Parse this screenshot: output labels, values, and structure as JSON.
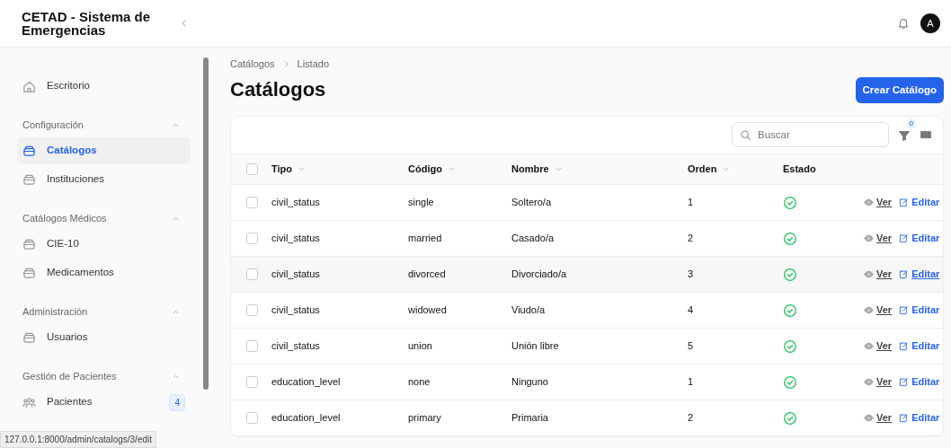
{
  "sidebar": {
    "title": "CETAD - Sistema de Emergencias",
    "top_items": [
      {
        "label": "Escritorio",
        "kind": "home",
        "selected": false
      }
    ],
    "groups": [
      {
        "title": "Configuración",
        "expanded": true,
        "items": [
          {
            "label": "Catálogos",
            "kind": "box",
            "selected": true
          },
          {
            "label": "Instituciones",
            "kind": "box",
            "selected": false
          }
        ]
      },
      {
        "title": "Catálogos Médicos",
        "expanded": true,
        "items": [
          {
            "label": "CIE-10",
            "kind": "box",
            "selected": false
          },
          {
            "label": "Medicamentos",
            "kind": "box",
            "selected": false
          }
        ]
      },
      {
        "title": "Administración",
        "expanded": true,
        "items": [
          {
            "label": "Usuarios",
            "kind": "box",
            "selected": false
          }
        ]
      },
      {
        "title": "Gestión de Pacientes",
        "expanded": true,
        "items": [
          {
            "label": "Pacientes",
            "kind": "users",
            "selected": false,
            "badge": "4"
          }
        ]
      }
    ]
  },
  "header": {
    "avatar": "A"
  },
  "breadcrumbs": [
    "Catálogos",
    "Listado"
  ],
  "page_title": "Catálogos",
  "create_button": "Crear Catálogo",
  "search": {
    "placeholder": "Buscar"
  },
  "filter_count": "0",
  "table": {
    "select_all_checked": false,
    "columns": [
      {
        "label": "Tipo",
        "sortable": true
      },
      {
        "label": "Código",
        "sortable": true
      },
      {
        "label": "Nombre",
        "sortable": true
      },
      {
        "label": "Orden",
        "sortable": true
      },
      {
        "label": "Estado",
        "sortable": false
      }
    ],
    "rows": [
      {
        "cells": [
          "civil_status",
          "single",
          "Soltero/a",
          "1"
        ],
        "active": true,
        "checked": false,
        "hovered": false,
        "actions": [
          "Ver",
          "Editar"
        ]
      },
      {
        "cells": [
          "civil_status",
          "married",
          "Casado/a",
          "2"
        ],
        "active": true,
        "checked": false,
        "hovered": false,
        "actions": [
          "Ver",
          "Editar"
        ]
      },
      {
        "cells": [
          "civil_status",
          "divorced",
          "Divorciado/a",
          "3"
        ],
        "active": true,
        "checked": false,
        "hovered": true,
        "actions": [
          "Ver",
          "Editar"
        ]
      },
      {
        "cells": [
          "civil_status",
          "widowed",
          "Viudo/a",
          "4"
        ],
        "active": true,
        "checked": false,
        "hovered": false,
        "actions": [
          "Ver",
          "Editar"
        ]
      },
      {
        "cells": [
          "civil_status",
          "union",
          "Unión libre",
          "5"
        ],
        "active": true,
        "checked": false,
        "hovered": false,
        "actions": [
          "Ver",
          "Editar"
        ]
      },
      {
        "cells": [
          "education_level",
          "none",
          "Ninguno",
          "1"
        ],
        "active": true,
        "checked": false,
        "hovered": false,
        "actions": [
          "Ver",
          "Editar"
        ]
      },
      {
        "cells": [
          "education_level",
          "primary",
          "Primaria",
          "2"
        ],
        "active": true,
        "checked": false,
        "hovered": false,
        "actions": [
          "Ver",
          "Editar"
        ]
      }
    ]
  },
  "status_url": "127.0.0.1:8000/admin/catalogs/3/edit"
}
